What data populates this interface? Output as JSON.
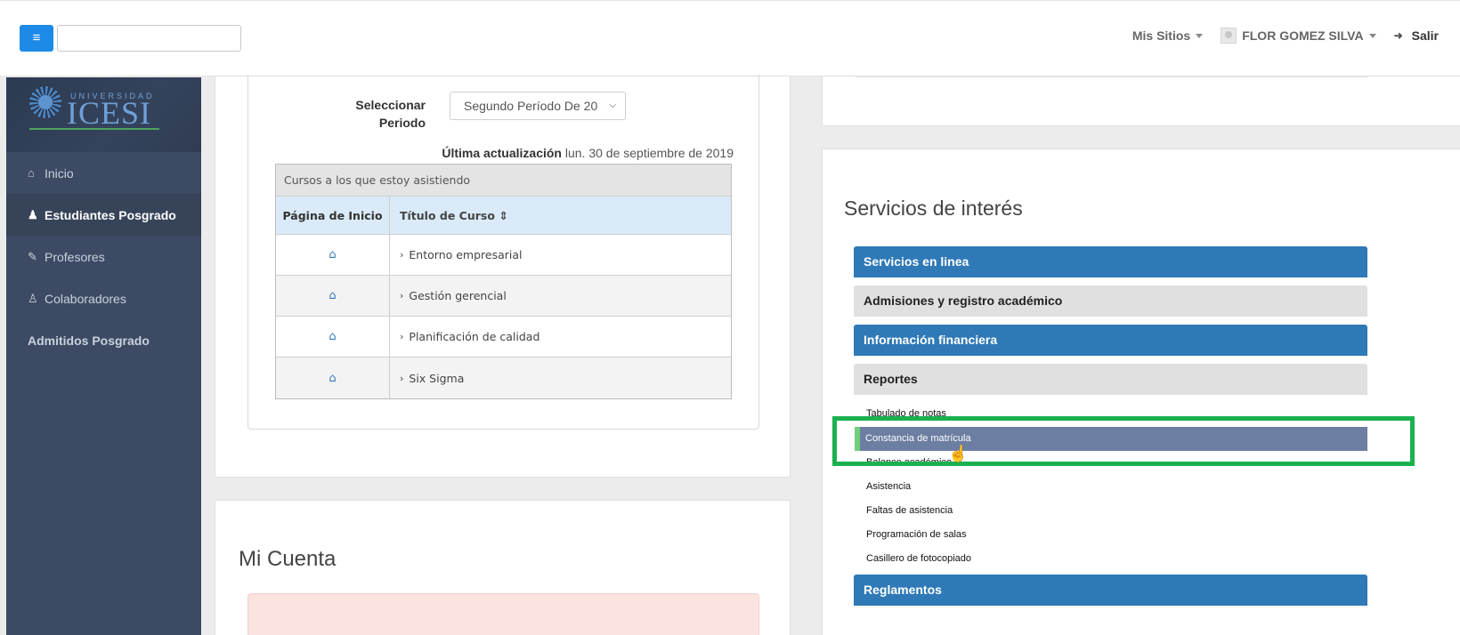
{
  "header": {
    "menu_icon": "hamburger-icon",
    "search_value": "",
    "my_sites": "Mis Sitios",
    "user_name": "FLOR GOMEZ SILVA",
    "logout": "Salir",
    "accent": "#1d8ae8"
  },
  "logo": {
    "top_text": "UNIVERSIDAD",
    "name": "ICESI"
  },
  "sidebar": {
    "items": [
      {
        "label": "Inicio",
        "icon": "home-icon"
      },
      {
        "label": "Estudiantes Posgrado",
        "icon": "student-icon"
      },
      {
        "label": "Profesores",
        "icon": "professor-icon"
      },
      {
        "label": "Colaboradores",
        "icon": "collaborator-icon"
      },
      {
        "label": "Admitidos Posgrado",
        "icon": ""
      }
    ]
  },
  "courses_panel": {
    "period_label": "Seleccionar Periodo",
    "period_value": "Segundo Período De 20",
    "updated_label": "Última actualización",
    "updated_date": "lun. 30 de septiembre de 2019",
    "table_caption": "Cursos a los que estoy asistiendo",
    "col_home": "Página de Inicio",
    "col_title": "Título de Curso",
    "rows": [
      {
        "title": "Entorno empresarial"
      },
      {
        "title": "Gestión gerencial"
      },
      {
        "title": "Planificación de calidad"
      },
      {
        "title": "Six Sigma"
      }
    ]
  },
  "account": {
    "title": "Mi Cuenta"
  },
  "services": {
    "title": "Servicios de interés",
    "sections": [
      "Servicios en linea",
      "Admisiones y registro académico",
      "Información financiera",
      "Reportes",
      "Reglamentos"
    ],
    "report_links": [
      "Tabulado de notas",
      "Constancia de matrícula",
      "Balance académico",
      "Asistencia",
      "Faltas de asistencia",
      "Programación de salas",
      "Casillero de fotocopiado"
    ]
  }
}
